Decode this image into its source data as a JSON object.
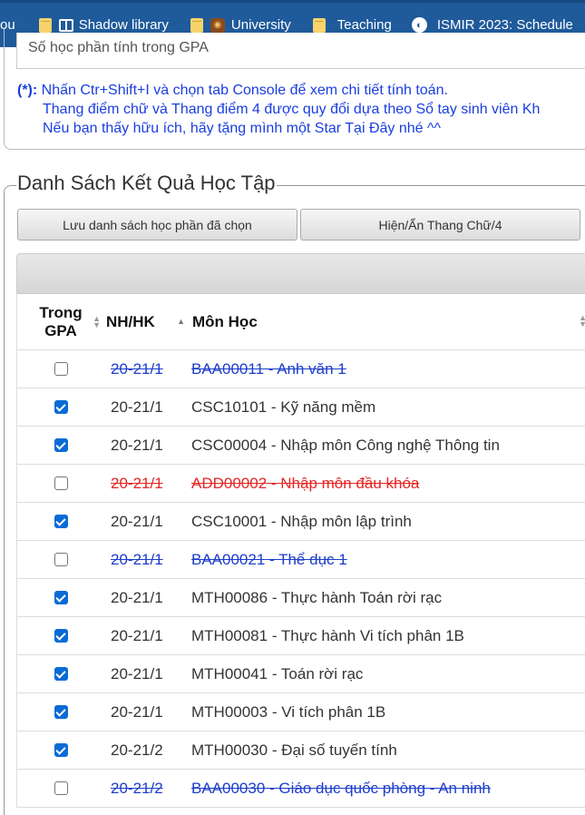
{
  "bookmarks": [
    {
      "label": "ou",
      "icon": "none"
    },
    {
      "label": "Shadow library",
      "icon": "book-icon"
    },
    {
      "label": "University",
      "icon": "owl-icon"
    },
    {
      "label": "Teaching",
      "icon": "folder-icon"
    },
    {
      "label": "ISMIR 2023: Schedule",
      "icon": "globe-icon"
    }
  ],
  "info": {
    "gpa_count_label": "Số học phần tính trong GPA",
    "note_star": "(*):",
    "note_line1": " Nhấn Ctr+Shift+I và chọn tab Console để xem chi tiết tính toán.",
    "note_line2": "Thang điểm chữ và Thang điểm 4 được quy đổi dựa theo Sổ tay sinh viên Kh",
    "note_line3_prefix": "Nếu bạn thấy hữu ích, hãy tặng mình một Star ",
    "note_line3_link": "Tại Đây",
    "note_line3_suffix": " nhé ^^"
  },
  "results": {
    "legend": "Danh Sách Kết Quả Học Tập",
    "save_button": "Lưu danh sách học phần đã chọn",
    "toggle_button": "Hiện/Ẩn Thang Chữ/4",
    "columns": {
      "gpa_line1": "Trong",
      "gpa_line2": "GPA",
      "term": "NH/HK",
      "course": "Môn Học"
    },
    "rows": [
      {
        "checked": false,
        "term": "20-21/1",
        "code": "BAA00011",
        "name": " - Anh văn 1",
        "style": "struck-blue"
      },
      {
        "checked": true,
        "term": "20-21/1",
        "code": "CSC10101",
        "name": " - Kỹ năng mềm",
        "style": "normal"
      },
      {
        "checked": true,
        "term": "20-21/1",
        "code": "CSC00004",
        "name": " - Nhập môn Công nghệ Thông tin",
        "style": "normal"
      },
      {
        "checked": false,
        "term": "20-21/1",
        "code": "ADD00002",
        "name": " - Nhập môn đầu khóa",
        "style": "struck-red"
      },
      {
        "checked": true,
        "term": "20-21/1",
        "code": "CSC10001",
        "name": " - Nhập môn lập trình",
        "style": "normal"
      },
      {
        "checked": false,
        "term": "20-21/1",
        "code": "BAA00021",
        "name": " - Thể dục 1",
        "style": "struck-blue"
      },
      {
        "checked": true,
        "term": "20-21/1",
        "code": "MTH00086",
        "name": " - Thực hành Toán rời rạc",
        "style": "normal"
      },
      {
        "checked": true,
        "term": "20-21/1",
        "code": "MTH00081",
        "name": " - Thực hành Vi tích phân 1B",
        "style": "normal"
      },
      {
        "checked": true,
        "term": "20-21/1",
        "code": "MTH00041",
        "name": " - Toán rời rạc",
        "style": "normal"
      },
      {
        "checked": true,
        "term": "20-21/1",
        "code": "MTH00003",
        "name": " - Vi tích phân 1B",
        "style": "normal"
      },
      {
        "checked": true,
        "term": "20-21/2",
        "code": "MTH00030",
        "name": " - Đại số tuyến tính",
        "style": "normal"
      },
      {
        "checked": false,
        "term": "20-21/2",
        "code": "BAA00030",
        "name": " - Giáo dục quốc phòng - An ninh",
        "style": "struck-blue"
      }
    ]
  }
}
